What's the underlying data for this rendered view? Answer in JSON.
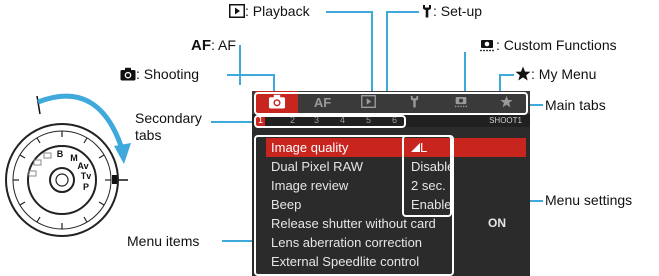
{
  "callouts": {
    "playback": {
      "label": ": Playback",
      "icon": "playback-icon"
    },
    "setup": {
      "label": ": Set-up",
      "icon": "wrench-icon"
    },
    "af": {
      "prefix": "AF",
      "label": ": AF"
    },
    "custom": {
      "label": ": Custom Functions",
      "icon": "custom-functions-icon"
    },
    "shooting": {
      "label": ": Shooting",
      "icon": "camera-icon"
    },
    "mymenu": {
      "label": ": My Menu",
      "icon": "star-icon"
    },
    "secondary": {
      "label1": "Secondary",
      "label2": "tabs"
    },
    "maintabs": {
      "label": "Main tabs"
    },
    "menusettings": {
      "label": "Menu settings"
    },
    "menuitems": {
      "label": "Menu items"
    }
  },
  "screen": {
    "tabs": [
      {
        "name": "shooting",
        "icon": "camera-icon",
        "text": "",
        "active": true
      },
      {
        "name": "af",
        "icon": "",
        "text": "AF",
        "active": false
      },
      {
        "name": "playback",
        "icon": "playback-icon",
        "text": "",
        "active": false
      },
      {
        "name": "setup",
        "icon": "wrench-icon",
        "text": "",
        "active": false
      },
      {
        "name": "custom",
        "icon": "custom-functions-icon",
        "text": "",
        "active": false
      },
      {
        "name": "mymenu",
        "icon": "star-icon",
        "text": "",
        "active": false
      }
    ],
    "subtabs": [
      "1",
      "2",
      "3",
      "4",
      "5",
      "6"
    ],
    "page_name": "SHOOT1",
    "rows": [
      {
        "item": "Image quality",
        "value": "L",
        "selected": true
      },
      {
        "item": "Dual Pixel RAW",
        "value": "Disable",
        "selected": false
      },
      {
        "item": "Image review",
        "value": "2 sec.",
        "selected": false
      },
      {
        "item": "Beep",
        "value": "Enable",
        "selected": false
      },
      {
        "item": "Release shutter without card",
        "value": "ON",
        "selected": false
      },
      {
        "item": "Lens aberration correction",
        "value": "",
        "selected": false
      },
      {
        "item": "External Speedlite control",
        "value": "",
        "selected": false
      }
    ]
  },
  "dial": {
    "modes": [
      "B",
      "M",
      "Av",
      "Tv",
      "P"
    ]
  },
  "colors": {
    "accent": "#3fa9dc",
    "tab_active": "#c8251f",
    "screen_bg": "#2b2b2b"
  }
}
